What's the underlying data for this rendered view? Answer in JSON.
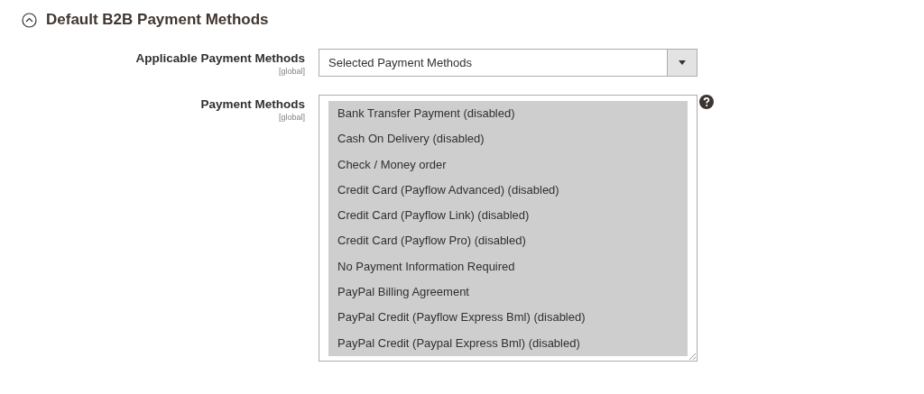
{
  "section": {
    "title": "Default B2B Payment Methods",
    "expanded": true
  },
  "fields": [
    {
      "kind": "select",
      "label": "Applicable Payment Methods",
      "scope": "[global]",
      "value": "Selected Payment Methods"
    },
    {
      "kind": "multiselect",
      "label": "Payment Methods",
      "scope": "[global]",
      "help": true,
      "options": [
        {
          "label": "Bank Transfer Payment (disabled)",
          "selected": true
        },
        {
          "label": "Cash On Delivery (disabled)",
          "selected": true
        },
        {
          "label": "Check / Money order",
          "selected": true
        },
        {
          "label": "Credit Card (Payflow Advanced) (disabled)",
          "selected": true
        },
        {
          "label": "Credit Card (Payflow Link) (disabled)",
          "selected": true
        },
        {
          "label": "Credit Card (Payflow Pro) (disabled)",
          "selected": true
        },
        {
          "label": "No Payment Information Required",
          "selected": true
        },
        {
          "label": "PayPal Billing Agreement",
          "selected": true
        },
        {
          "label": "PayPal Credit (Payflow Express Bml) (disabled)",
          "selected": true
        },
        {
          "label": "PayPal Credit (Paypal Express Bml) (disabled)",
          "selected": true
        }
      ]
    }
  ]
}
